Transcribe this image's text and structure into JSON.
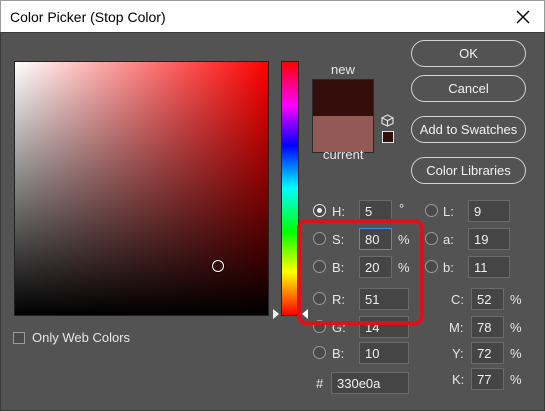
{
  "window": {
    "title": "Color Picker (Stop Color)"
  },
  "preview": {
    "new_label": "new",
    "current_label": "current",
    "new_color": "#330e0a",
    "current_color": "#935a55"
  },
  "buttons": {
    "ok": "OK",
    "cancel": "Cancel",
    "add_to_swatches": "Add to Swatches",
    "color_libraries": "Color Libraries"
  },
  "hsb": [
    {
      "label": "H:",
      "value": "5",
      "unit": "°"
    },
    {
      "label": "S:",
      "value": "80",
      "unit": "%"
    },
    {
      "label": "B:",
      "value": "20",
      "unit": "%"
    }
  ],
  "rgb": [
    {
      "label": "R:",
      "value": "51"
    },
    {
      "label": "G:",
      "value": "14"
    },
    {
      "label": "B:",
      "value": "10"
    }
  ],
  "lab": [
    {
      "label": "L:",
      "value": "9"
    },
    {
      "label": "a:",
      "value": "19"
    },
    {
      "label": "b:",
      "value": "11"
    }
  ],
  "cmyk": [
    {
      "label": "C:",
      "value": "52",
      "unit": "%"
    },
    {
      "label": "M:",
      "value": "78",
      "unit": "%"
    },
    {
      "label": "Y:",
      "value": "72",
      "unit": "%"
    },
    {
      "label": "K:",
      "value": "77",
      "unit": "%"
    }
  ],
  "hex": {
    "label": "#",
    "value": "330e0a"
  },
  "web_colors": {
    "label": "Only Web Colors",
    "checked": false
  },
  "colors": {
    "highlight": "#e0101b",
    "dialog_bg": "#535353",
    "field_focus": "#3f8ee0"
  },
  "icons": {
    "close": "close-icon",
    "cube": "cube-icon",
    "gamut": "gamut-swatch-icon"
  }
}
